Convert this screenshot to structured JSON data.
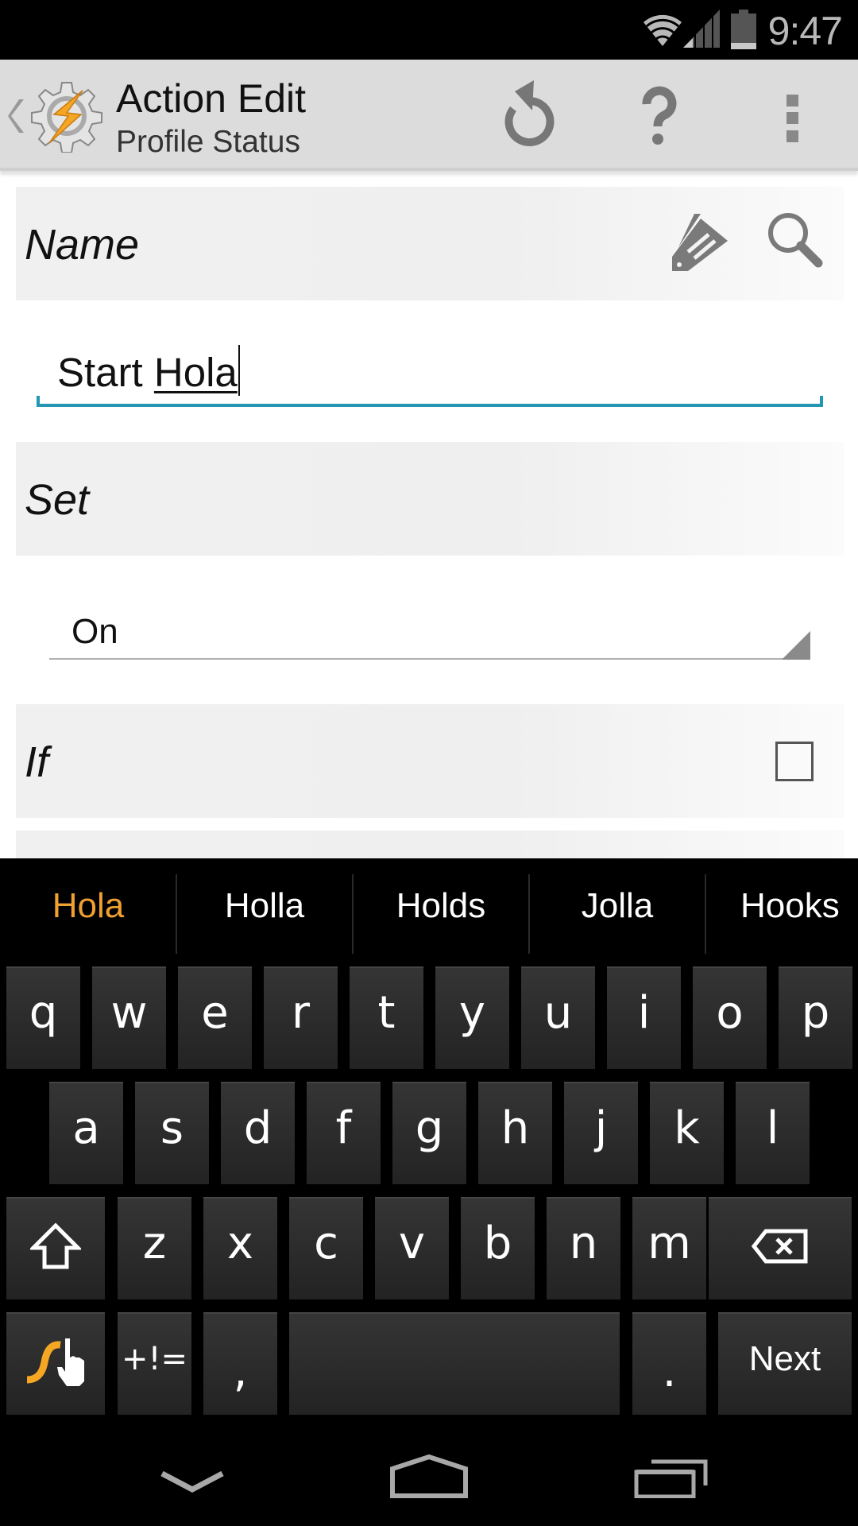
{
  "status_bar": {
    "time": "9:47",
    "icons": [
      "wifi-icon",
      "cell-signal-icon",
      "battery-icon"
    ]
  },
  "action_bar": {
    "title": "Action Edit",
    "subtitle": "Profile Status",
    "app_icon": "tasker-gear-bolt-icon",
    "actions": [
      {
        "name": "undo",
        "icon": "undo-icon"
      },
      {
        "name": "help",
        "icon": "help-icon",
        "glyph": "?"
      },
      {
        "name": "overflow",
        "icon": "overflow-menu-icon"
      }
    ]
  },
  "form": {
    "name_section": {
      "label": "Name",
      "icons": [
        "tag-edit-icon",
        "search-icon"
      ],
      "value_prefix": "Start ",
      "value_composing": "Hola"
    },
    "set_section": {
      "label": "Set",
      "selected_value": "On"
    },
    "if_section": {
      "label": "If",
      "checked": false
    }
  },
  "keyboard": {
    "suggestions": [
      {
        "text": "Hola",
        "highlighted": true
      },
      {
        "text": "Holla",
        "highlighted": false
      },
      {
        "text": "Holds",
        "highlighted": false
      },
      {
        "text": "Jolla",
        "highlighted": false
      },
      {
        "text": "Hooks",
        "highlighted": false
      }
    ],
    "row1": [
      "q",
      "w",
      "e",
      "r",
      "t",
      "y",
      "u",
      "i",
      "o",
      "p"
    ],
    "row2": [
      "a",
      "s",
      "d",
      "f",
      "g",
      "h",
      "j",
      "k",
      "l"
    ],
    "row3": [
      "z",
      "x",
      "c",
      "v",
      "b",
      "n",
      "m"
    ],
    "symbols_label": "+!=",
    "comma": ",",
    "period": ".",
    "action_label": "Next"
  },
  "colors": {
    "accent": "#2296b3",
    "suggestion_highlight": "#f0a030",
    "swype_orange": "#f5a623"
  },
  "nav_bar": {
    "buttons": [
      "hide-keyboard-icon",
      "home-icon",
      "recents-icon"
    ]
  }
}
